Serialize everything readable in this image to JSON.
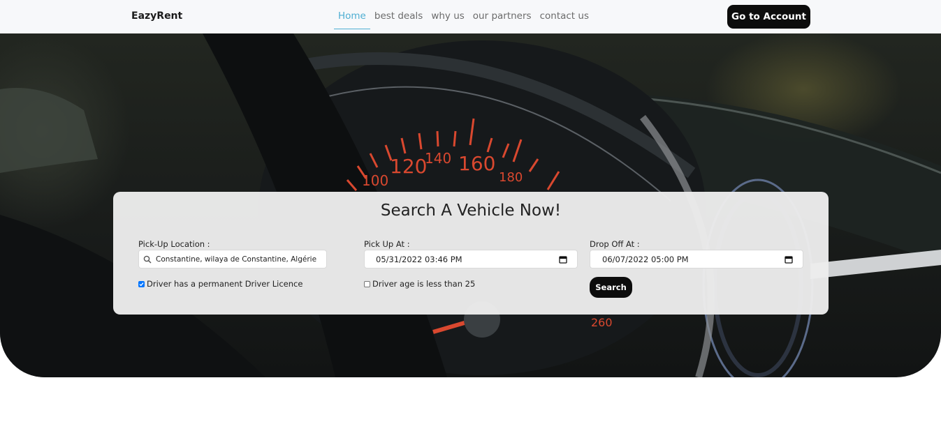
{
  "nav": {
    "brand": "EazyRent",
    "links": [
      {
        "label": "Home",
        "active": true
      },
      {
        "label": "best deals",
        "active": false
      },
      {
        "label": "why us",
        "active": false
      },
      {
        "label": "our partners",
        "active": false
      },
      {
        "label": "contact us",
        "active": false
      }
    ],
    "account_button": "Go to Account"
  },
  "hero": {
    "speedometer_labels": [
      "100",
      "120",
      "140",
      "160",
      "180",
      "260"
    ]
  },
  "search": {
    "title": "Search A Vehicle Now!",
    "pickup_location": {
      "label": "Pick-Up Location :",
      "value": "Constantine, wilaya de Constantine, Algérie",
      "icon": "search-icon"
    },
    "pickup_at": {
      "label": "Pick Up At :",
      "value": "05/31/2022 03:46  PM",
      "icon": "calendar-icon"
    },
    "dropoff_at": {
      "label": "Drop Off At :",
      "value": "06/07/2022 05:00  PM",
      "icon": "calendar-icon"
    },
    "licence_checkbox": {
      "label": "Driver has a permanent Driver Licence",
      "checked": true
    },
    "age_checkbox": {
      "label": "Driver age is less than 25",
      "checked": false
    },
    "search_button": "Search"
  },
  "colors": {
    "accent": "#4eaed2",
    "button": "#0c0c0c",
    "checkbox": "#0075ff"
  }
}
